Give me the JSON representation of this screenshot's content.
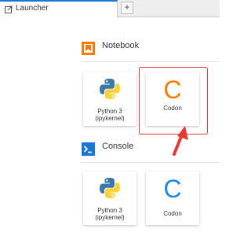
{
  "tab": {
    "label": "Launcher",
    "icon": "launcher-icon",
    "add_label": "+"
  },
  "accent_color": "#1976d2",
  "notebook_section": {
    "title": "Notebook",
    "icon": "notebook-icon",
    "icon_color": "#f57c00",
    "cards": [
      {
        "label_line1": "Python 3",
        "label_line2": "(ipykernel)",
        "icon": "python-logo"
      },
      {
        "label": "Codon",
        "letter": "C",
        "letter_color": "#f57c00",
        "icon": "codon-logo"
      }
    ]
  },
  "console_section": {
    "title": "Console",
    "icon": "console-icon",
    "icon_color": "#1976d2",
    "cards": [
      {
        "label_line1": "Python 3",
        "label_line2": "(ipykernel)",
        "icon": "python-logo"
      },
      {
        "label": "Codon",
        "letter": "C",
        "letter_color": "#1e88e5",
        "icon": "codon-logo"
      }
    ]
  },
  "annotation": {
    "highlight_color": "#e53935"
  }
}
